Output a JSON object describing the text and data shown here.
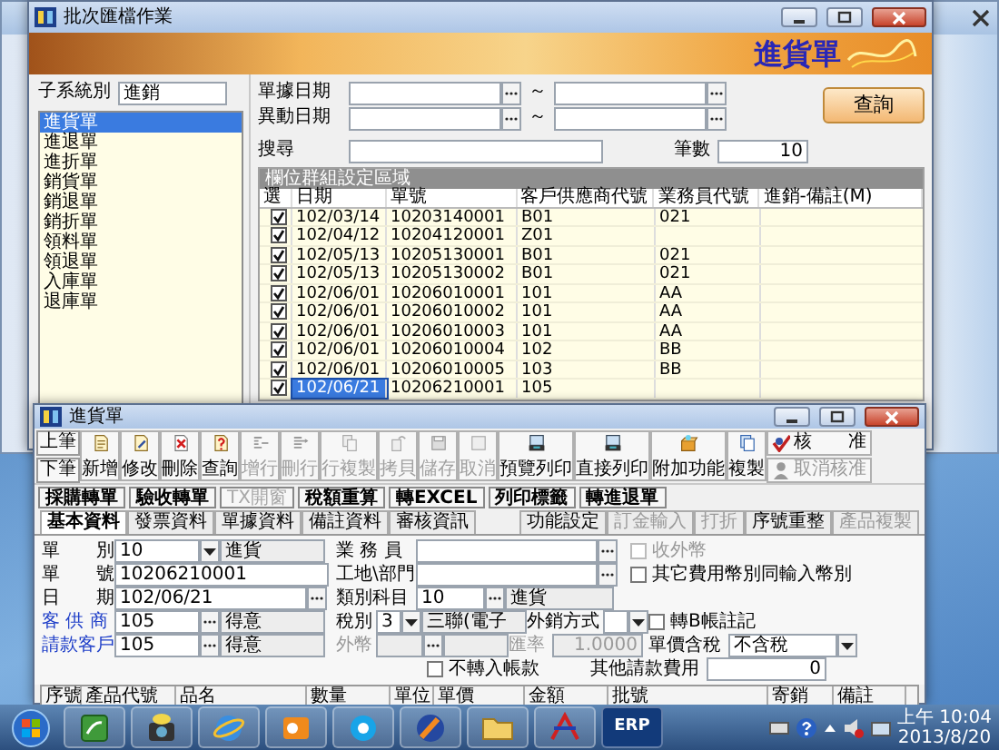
{
  "batch_window": {
    "title": "批次匯檔作業",
    "banner": "進貨單",
    "subsystem_label": "子系統別",
    "subsystem_value": "進銷",
    "doc_types": [
      {
        "label": "進貨單",
        "selected": true
      },
      {
        "label": "進退單",
        "selected": false
      },
      {
        "label": "進折單",
        "selected": false
      },
      {
        "label": "銷貨單",
        "selected": false
      },
      {
        "label": "銷退單",
        "selected": false
      },
      {
        "label": "銷折單",
        "selected": false
      },
      {
        "label": "領料單",
        "selected": false
      },
      {
        "label": "領退單",
        "selected": false
      },
      {
        "label": "入庫單",
        "selected": false
      },
      {
        "label": "退庫單",
        "selected": false
      }
    ],
    "filters": [
      {
        "label": "單據日期",
        "separator": "～"
      },
      {
        "label": "異動日期",
        "separator": "～"
      }
    ],
    "search_label": "搜尋",
    "count_label": "筆數",
    "count_value": "10",
    "query_button": "查詢",
    "grid": {
      "title": "欄位群組設定區域",
      "columns": [
        "選",
        "日期",
        "單號",
        "客戶供應商代號",
        "業務員代號",
        "進銷-備註(M)"
      ],
      "rows": [
        {
          "checked": true,
          "selected": false,
          "date": "102/03/14",
          "number": "10203140001",
          "vendor": "B01",
          "salesperson": "021"
        },
        {
          "checked": true,
          "selected": false,
          "date": "102/04/12",
          "number": "10204120001",
          "vendor": "Z01"
        },
        {
          "checked": true,
          "selected": false,
          "date": "102/05/13",
          "number": "10205130001",
          "vendor": "B01",
          "salesperson": "021"
        },
        {
          "checked": true,
          "selected": false,
          "date": "102/05/13",
          "number": "10205130002",
          "vendor": "B01",
          "salesperson": "021"
        },
        {
          "checked": true,
          "selected": false,
          "date": "102/06/01",
          "number": "10206010001",
          "vendor": "101",
          "salesperson": "AA"
        },
        {
          "checked": true,
          "selected": false,
          "date": "102/06/01",
          "number": "10206010002",
          "vendor": "101",
          "salesperson": "AA"
        },
        {
          "checked": true,
          "selected": false,
          "date": "102/06/01",
          "number": "10206010003",
          "vendor": "101",
          "salesperson": "AA"
        },
        {
          "checked": true,
          "selected": false,
          "date": "102/06/01",
          "number": "10206010004",
          "vendor": "102",
          "salesperson": "BB"
        },
        {
          "checked": true,
          "selected": false,
          "date": "102/06/01",
          "number": "10206010005",
          "vendor": "103",
          "salesperson": "BB"
        },
        {
          "checked": true,
          "selected": true,
          "date": "102/06/21",
          "number": "10206210001",
          "vendor": "105"
        }
      ]
    }
  },
  "order_window": {
    "title": "進貨單",
    "nav_buttons": [
      "上筆",
      "下筆"
    ],
    "toolbar": [
      {
        "label": "新增",
        "kind": "new",
        "disabled": false
      },
      {
        "label": "修改",
        "kind": "edit",
        "disabled": false
      },
      {
        "label": "刪除",
        "kind": "delete",
        "disabled": false
      },
      {
        "label": "查詢",
        "kind": "query",
        "disabled": false
      },
      {
        "label": "增行",
        "kind": "addrow",
        "disabled": true
      },
      {
        "label": "刪行",
        "kind": "delrow",
        "disabled": true
      },
      {
        "label": "行複製",
        "kind": "copyrow",
        "disabled": true
      },
      {
        "label": "拷貝",
        "kind": "duplicate",
        "disabled": true
      },
      {
        "label": "儲存",
        "kind": "save",
        "disabled": true
      },
      {
        "label": "取消",
        "kind": "cancel",
        "disabled": true
      },
      {
        "label": "預覽列印",
        "kind": "print",
        "disabled": false
      },
      {
        "label": "直接列印",
        "kind": "print",
        "disabled": false
      },
      {
        "label": "附加功能",
        "kind": "addon",
        "disabled": false
      },
      {
        "label": "複製",
        "kind": "clone",
        "disabled": false
      }
    ],
    "approve_buttons": [
      {
        "label": "核　　准",
        "kind": "approve",
        "disabled": false
      },
      {
        "label": "取消核准",
        "kind": "unapprove",
        "disabled": true
      }
    ],
    "function_buttons": [
      {
        "label": "採購轉單",
        "disabled": false
      },
      {
        "label": "驗收轉單",
        "disabled": false
      },
      {
        "label": "TX開窗",
        "disabled": true
      },
      {
        "label": "稅額重算",
        "disabled": false
      },
      {
        "label": "轉EXCEL",
        "disabled": false
      },
      {
        "label": "列印標籤",
        "disabled": false
      },
      {
        "label": "轉進退單",
        "disabled": false
      }
    ],
    "tabs": [
      {
        "label": "基本資料",
        "selected": true
      },
      {
        "label": "發票資料",
        "selected": false
      },
      {
        "label": "單據資料",
        "selected": false
      },
      {
        "label": "備註資料",
        "selected": false
      },
      {
        "label": "審核資訊",
        "selected": false
      }
    ],
    "side_tabs": [
      {
        "label": "功能設定",
        "disabled": false
      },
      {
        "label": "訂金輸入",
        "disabled": true
      },
      {
        "label": "打折",
        "disabled": true
      },
      {
        "label": "序號重整",
        "disabled": false
      },
      {
        "label": "產品複製",
        "disabled": true
      }
    ],
    "form": {
      "doc_kind": {
        "label": "單　　別",
        "code": "10",
        "name": "進貨"
      },
      "doc_no": {
        "label": "單　　號",
        "value": "10206210001"
      },
      "date": {
        "label": "日　　期",
        "value": "102/06/21"
      },
      "vendor": {
        "label": "客 供 商",
        "code": "105",
        "name": "得意"
      },
      "billing": {
        "label": "請款客戶",
        "code": "105",
        "name": "得意"
      },
      "salesperson": {
        "label": "業 務 員"
      },
      "department": {
        "label": "工地\\部門"
      },
      "category": {
        "label": "類別科目",
        "code": "10",
        "name": "進貨"
      },
      "tax": {
        "label": "稅別",
        "code": "3",
        "name": "三聯(電子"
      },
      "currency": {
        "label": "外幣",
        "disabled": true
      },
      "export": {
        "label": "外銷方式"
      },
      "rate": {
        "label": "匯率",
        "value": "1.0000",
        "disabled": true
      },
      "options": [
        {
          "label": "收外幣",
          "checked": false,
          "disabled": true
        },
        {
          "label": "其它費用幣別同輸入幣別",
          "checked": false,
          "disabled": false
        },
        {
          "label": "轉B帳註記",
          "checked": false,
          "disabled": false
        }
      ],
      "tax_included": {
        "label": "單價含稅",
        "value": "不含稅"
      },
      "no_ledger": {
        "label": "不轉入帳款",
        "checked": false
      },
      "other_fee": {
        "label": "其他請款費用",
        "value": "0"
      }
    },
    "detail_columns": [
      "序號",
      "產品代號",
      "品名",
      "數量",
      "單位",
      "單價",
      "金額",
      "批號",
      "寄銷",
      "備註"
    ]
  },
  "taskbar": {
    "erp_label": "ERP",
    "time": "上午 10:04",
    "date": "2013/8/20"
  }
}
